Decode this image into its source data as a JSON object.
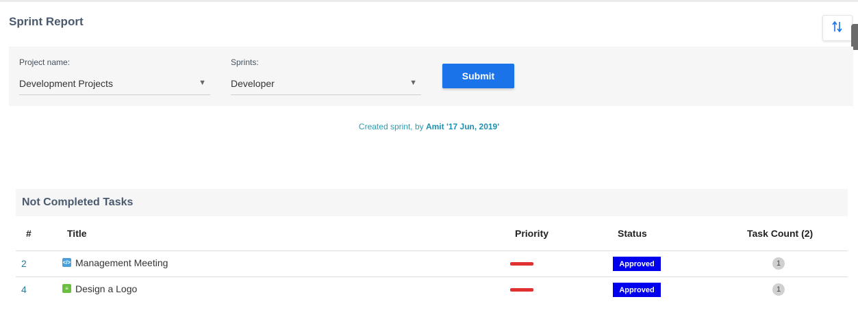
{
  "page": {
    "title": "Sprint Report"
  },
  "toolbar": {
    "sort_icon": "sort-arrows-icon"
  },
  "filters": {
    "project_label": "Project name:",
    "project_value": "Development Projects",
    "sprints_label": "Sprints:",
    "sprints_value": "Developer",
    "dropdown_arrow": "▼",
    "submit_label": "Submit"
  },
  "created": {
    "prefix": "Created sprint, by ",
    "author": "Amit",
    "date": "'17 Jun, 2019'"
  },
  "section": {
    "title": "Not Completed Tasks",
    "columns": {
      "num": "#",
      "title": "Title",
      "priority": "Priority",
      "status": "Status",
      "task_count": "Task Count (2)"
    },
    "rows": [
      {
        "num": "2",
        "icon": "code-icon",
        "icon_color": "#4a9fd8",
        "title": "Management Meeting",
        "priority_color": "#e03030",
        "status": "Approved",
        "count": "1"
      },
      {
        "num": "4",
        "icon": "design-icon",
        "icon_color": "#6abf3f",
        "title": "Design a Logo",
        "priority_color": "#e03030",
        "status": "Approved",
        "count": "1"
      }
    ]
  },
  "colors": {
    "accent": "#1a73e8",
    "status_bg": "#0000ee",
    "priority": "#e03030",
    "link": "#2a9bb0"
  }
}
